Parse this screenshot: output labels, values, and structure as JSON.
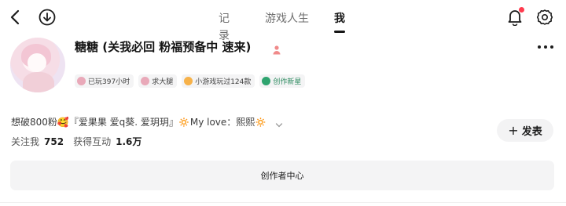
{
  "nav": {
    "tabs": [
      "记录",
      "游戏人生",
      "我"
    ],
    "active_tab": "我",
    "icons": [
      "back-icon",
      "download-icon",
      "bell-icon",
      "gear-icon"
    ],
    "notification_dot_color": "#ff3b4e"
  },
  "profile": {
    "name": "糖糖 (关我必回 粉福预备中 速来)",
    "badges": [
      {
        "icon": "avatar-icon",
        "label": "已玩397小时"
      },
      {
        "icon": "avatar-icon",
        "label": "求大腿"
      },
      {
        "icon": "game-icon",
        "label": "小游戏玩过124款"
      },
      {
        "icon": "creator-icon",
        "label": "创作新星"
      }
    ],
    "bio": "想破800粉🥰『爱果果 爱q葵. 爱玥玥』🔅My love：熙熙🔅",
    "stats": {
      "followers_label": "关注我",
      "followers": "752",
      "interactions_label": "获得互动",
      "interactions": "1.6万"
    }
  },
  "actions": {
    "post_label": "发表",
    "creator_center_label": "创作者中心"
  },
  "colors": {
    "accent_text": "#161616",
    "creator_badge": "#2fa46f"
  }
}
